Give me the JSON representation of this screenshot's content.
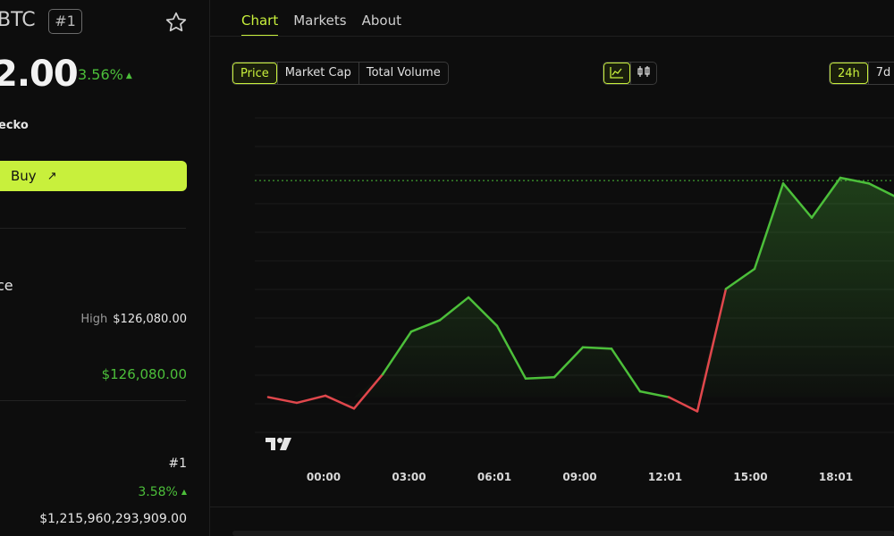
{
  "coin": {
    "ticker": "BTC",
    "rank_badge": "#1",
    "price": "2.00",
    "change": "3.56%",
    "source": "ecko"
  },
  "buy": {
    "label": "Buy",
    "arrow": "↗"
  },
  "stats": {
    "section_label": "ce",
    "high_label": "High",
    "high_value": "$126,080.00",
    "ath_value": "$126,080.00",
    "rank_value": "#1",
    "pct_value": "3.58%",
    "market_cap_value": "$1,215,960,293,909.00"
  },
  "tabs": [
    {
      "label": "Chart"
    },
    {
      "label": "Markets"
    },
    {
      "label": "About"
    }
  ],
  "metric_toggle": [
    {
      "label": "Price"
    },
    {
      "label": "Market Cap"
    },
    {
      "label": "Total Volume"
    }
  ],
  "range_toggle": [
    {
      "label": "24h"
    },
    {
      "label": "7d"
    }
  ],
  "colors": {
    "accent": "#c8f03c",
    "up": "#4cbf3a",
    "down": "#e0474c"
  },
  "icons": [
    "star-icon",
    "line-chart-icon",
    "candlestick-icon",
    "external-arrow-icon",
    "tradingview-logo"
  ],
  "chart_data": {
    "type": "line",
    "x_tick_labels": [
      "00:00",
      "03:00",
      "06:01",
      "09:00",
      "12:01",
      "15:00",
      "18:01"
    ],
    "series": [
      {
        "values": [
          0.0,
          -0.2,
          0.05,
          -0.4,
          0.8,
          2.3,
          2.7,
          3.5,
          2.5,
          0.65,
          0.7,
          1.75,
          1.7,
          0.2,
          0.0,
          -0.5,
          3.8,
          4.5,
          7.5,
          6.3,
          7.7,
          7.5,
          7.0
        ]
      }
    ],
    "baseline": 0.0,
    "reference_line": 7.6,
    "grid": true
  }
}
